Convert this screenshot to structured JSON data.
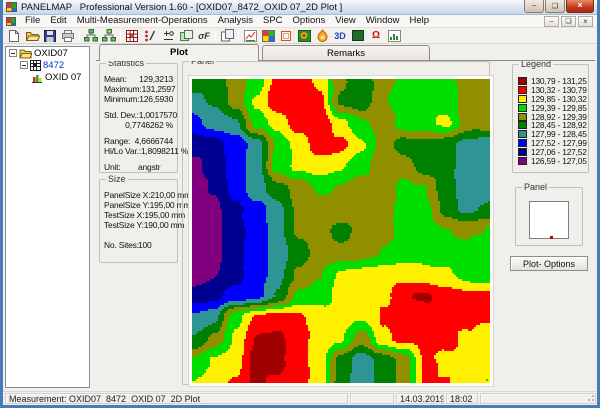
{
  "window": {
    "title": "PANELMAP   Professional Version 1.60 - [OXID07_8472_OXID 07_2D Plot ]"
  },
  "menu": {
    "items": [
      "File",
      "Edit",
      "Multi-Measurement-Operations",
      "Analysis",
      "SPC",
      "Options",
      "View",
      "Window",
      "Help"
    ]
  },
  "toolbar": {
    "icons": [
      "new-document",
      "open-folder",
      "save",
      "print",
      "multi-measurement-tree",
      "multi-measurement-link",
      "panel-editor",
      "site-editor",
      "statistics-calc",
      "panel-copy",
      "sigma-f",
      "copy",
      "trend-chart",
      "color-table",
      "panel-frame",
      "map-2d",
      "hotspot",
      "view-3d",
      "panel-fill",
      "omega-analysis",
      "histogram"
    ]
  },
  "tree": {
    "items": [
      {
        "label": "OXID07",
        "icon": "folder",
        "level": 0,
        "expander": true,
        "selected": false
      },
      {
        "label": "8472",
        "icon": "panel-grid",
        "level": 1,
        "expander": true,
        "selected": true
      },
      {
        "label": "OXID 07",
        "icon": "measurement-chart",
        "level": 2,
        "expander": false,
        "selected": false
      }
    ]
  },
  "tabs": {
    "plot": "Plot",
    "remarks": "Remarks"
  },
  "statistics": {
    "title": "Statistics",
    "rows": [
      {
        "label": "Mean:",
        "value": "129,3213"
      },
      {
        "label": "Maximum:",
        "value": "131,2597"
      },
      {
        "label": "Minimum:",
        "value": "126,5930"
      },
      {
        "label": "Std. Dev.:",
        "value": "1,0017570"
      },
      {
        "label": "",
        "value": "0,7746262 %"
      },
      {
        "label": "Range:",
        "value": "4,6666744"
      },
      {
        "label": "Hi/Lo Var.:",
        "value": "1,8098211 %"
      },
      {
        "label": "Unit:",
        "value": "angstr"
      }
    ]
  },
  "size": {
    "title": "Size",
    "rows": [
      {
        "label": "PanelSize X:",
        "value": "210,00 mm"
      },
      {
        "label": "PanelSize Y:",
        "value": "195,00 mm"
      },
      {
        "label": "TestSize X:",
        "value": "195,00 mm"
      },
      {
        "label": "TestSize Y:",
        "value": "190,00 mm"
      }
    ],
    "sites": {
      "label": "No. Sites:",
      "value": "100"
    }
  },
  "panel_box": {
    "title": "Panel"
  },
  "legend": {
    "title": "Legend"
  },
  "mini_panel": {
    "title": "Panel",
    "marker_color": "#C00000"
  },
  "plot_options": {
    "label": "Plot- Options"
  },
  "statusbar": {
    "measurement": "Measurement: OXID07_8472_OXID 07_2D Plot",
    "date": "14.03.2019",
    "time": "18:02"
  },
  "chart_data": {
    "type": "heatmap",
    "title": "Panel",
    "unit": "angstr",
    "value_range": [
      126.59,
      131.25
    ],
    "bins": [
      {
        "min": 130.79,
        "max": 131.25,
        "color": "#A00000",
        "label": "130,79 - 131,25"
      },
      {
        "min": 130.32,
        "max": 130.79,
        "color": "#FF0000",
        "label": "130,32 - 130,79"
      },
      {
        "min": 129.85,
        "max": 130.32,
        "color": "#FFF000",
        "label": "129,85 - 130,32"
      },
      {
        "min": 129.39,
        "max": 129.85,
        "color": "#00DF00",
        "label": "129,39 - 129,85"
      },
      {
        "min": 128.92,
        "max": 129.39,
        "color": "#8F8F00",
        "label": "128,92 - 129,39"
      },
      {
        "min": 128.45,
        "max": 128.92,
        "color": "#008000",
        "label": "128,45 - 128,92"
      },
      {
        "min": 127.99,
        "max": 128.45,
        "color": "#2E9494",
        "label": "127,99 - 128,45"
      },
      {
        "min": 127.52,
        "max": 127.99,
        "color": "#0000FF",
        "label": "127,52 - 127,99"
      },
      {
        "min": 127.06,
        "max": 127.52,
        "color": "#000090",
        "label": "127,06 - 127,52"
      },
      {
        "min": 126.59,
        "max": 127.06,
        "color": "#800080",
        "label": "126,59 - 127,05"
      }
    ],
    "grid_rows": 15,
    "grid_cols": 15,
    "values": [
      [
        128.7,
        128.6,
        129.1,
        129.6,
        130.5,
        130.6,
        130.2,
        129.0,
        128.6,
        129.2,
        129.5,
        129.6,
        129.5,
        129.2,
        129.1
      ],
      [
        128.3,
        128.5,
        129.1,
        129.9,
        130.7,
        130.7,
        130.5,
        128.8,
        128.6,
        129.35,
        129.6,
        129.7,
        129.6,
        129.2,
        129.1
      ],
      [
        127.8,
        128.2,
        128.3,
        129.6,
        130.0,
        130.6,
        130.7,
        130.0,
        129.45,
        129.15,
        129.6,
        129.7,
        129.95,
        129.15,
        129.1
      ],
      [
        127.2,
        127.35,
        127.7,
        128.2,
        129.5,
        130.0,
        130.6,
        130.45,
        129.9,
        129.2,
        128.7,
        128.7,
        128.6,
        128.3,
        128.2
      ],
      [
        126.9,
        127.25,
        127.7,
        128.25,
        129.6,
        130.0,
        130.1,
        129.9,
        129.5,
        129.15,
        129.1,
        128.7,
        128.55,
        128.2,
        128.1
      ],
      [
        126.8,
        127.1,
        127.7,
        128.25,
        128.75,
        129.1,
        129.5,
        129.3,
        129.15,
        129.1,
        129.5,
        129.4,
        128.6,
        128.15,
        128.1
      ],
      [
        126.7,
        126.95,
        127.4,
        127.8,
        128.3,
        129.0,
        129.15,
        129.2,
        129.15,
        129.3,
        129.55,
        129.5,
        128.7,
        128.35,
        128.55
      ],
      [
        126.7,
        126.9,
        127.35,
        127.75,
        128.25,
        129.0,
        129.2,
        128.75,
        129.0,
        129.2,
        129.6,
        129.55,
        129.45,
        129.3,
        129.4
      ],
      [
        126.75,
        126.9,
        127.4,
        127.7,
        128.2,
        128.7,
        129.1,
        129.05,
        129.2,
        129.45,
        129.6,
        129.65,
        129.6,
        129.55,
        129.6
      ],
      [
        126.8,
        127.0,
        127.4,
        127.75,
        128.25,
        129.0,
        129.4,
        129.9,
        130.0,
        130.05,
        130.1,
        130.0,
        129.95,
        129.6,
        129.5
      ],
      [
        127.3,
        127.4,
        127.7,
        127.85,
        128.5,
        129.45,
        129.7,
        130.0,
        130.1,
        130.2,
        130.7,
        130.85,
        130.5,
        130.45,
        130.45
      ],
      [
        128.0,
        128.3,
        129.7,
        130.4,
        130.6,
        130.45,
        130.0,
        129.95,
        129.9,
        130.4,
        130.6,
        130.55,
        130.5,
        130.45,
        130.35
      ],
      [
        128.45,
        129.05,
        129.9,
        130.85,
        130.9,
        130.5,
        130.1,
        129.9,
        129.1,
        130.25,
        130.45,
        130.5,
        130.45,
        130.2,
        130.0
      ],
      [
        129.5,
        129.9,
        130.1,
        131.0,
        130.9,
        130.5,
        130.15,
        128.7,
        128.2,
        128.6,
        129.1,
        130.4,
        130.25,
        130.1,
        129.9
      ],
      [
        129.9,
        130.05,
        130.4,
        130.85,
        130.7,
        130.45,
        130.2,
        128.6,
        128.2,
        128.6,
        129.1,
        130.4,
        130.35,
        130.0,
        129.85
      ]
    ]
  }
}
